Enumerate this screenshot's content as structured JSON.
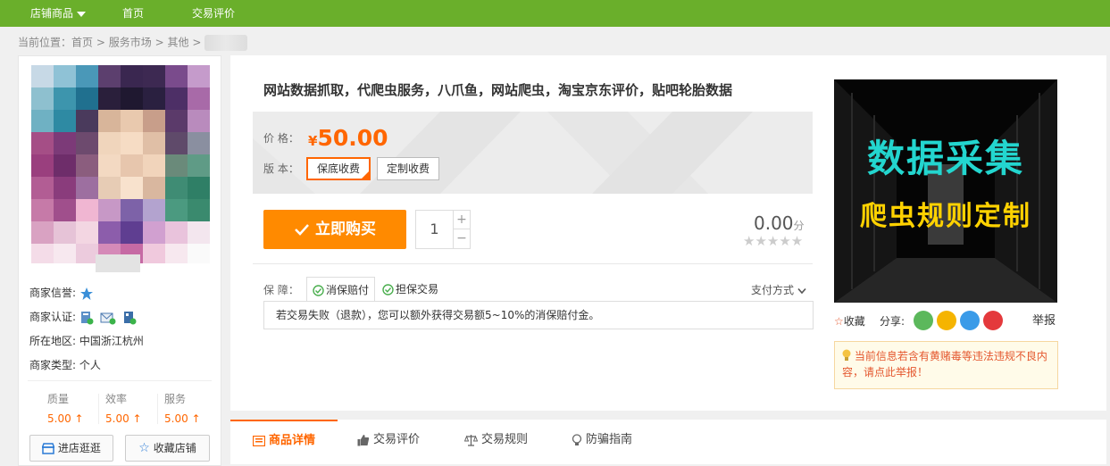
{
  "topbar": {
    "items": [
      {
        "label": "店铺商品"
      },
      {
        "label": "首页"
      },
      {
        "label": "交易评价"
      }
    ]
  },
  "breadcrumb": {
    "prefix": "当前位置：",
    "items": [
      "首页",
      "服务市场",
      "其他"
    ],
    "sep": ">"
  },
  "seller": {
    "credit_label": "商家信誉:",
    "auth_label": "商家认证:",
    "region_label": "所在地区:",
    "region_value": "中国浙江杭州",
    "type_label": "商家类型:",
    "type_value": "个人",
    "stats": [
      {
        "label": "质量",
        "value": "5.00 ↑"
      },
      {
        "label": "效率",
        "value": "5.00 ↑"
      },
      {
        "label": "服务",
        "value": "5.00 ↑"
      }
    ],
    "visit_button": "进店逛逛",
    "favorite_shop_button": "收藏店铺"
  },
  "product": {
    "title": "网站数据抓取，代爬虫服务，八爪鱼，网站爬虫，淘宝京东评价，贴吧轮胎数据",
    "price_label": "价  格：",
    "currency": "¥",
    "price": "50.00",
    "version_label": "版  本：",
    "versions": [
      "保底收费",
      "定制收费"
    ],
    "buy_button": "立即购买",
    "quantity": "1",
    "score": "0.00",
    "score_unit": "分",
    "stars": "★★★★★",
    "guarantee_label": "保  障：",
    "guarantees": [
      "消保赔付",
      "担保交易"
    ],
    "pay_method": "支付方式",
    "guarantee_desc": "若交易失败（退款），您可以额外获得交易额5~10%的消保赔付金。"
  },
  "ad": {
    "line1": "数据采集",
    "line2": "爬虫规则定制"
  },
  "actions": {
    "favorite": "收藏",
    "share_label": "分享:",
    "report": "举报",
    "warning": "当前信息若含有黄赌毒等违法违规不良内容，请点此举报！"
  },
  "tabs": [
    {
      "label": "商品详情"
    },
    {
      "label": "交易评价"
    },
    {
      "label": "交易规则"
    },
    {
      "label": "防骗指南"
    }
  ],
  "colors": {
    "topbar": "#6aaf2b",
    "accent": "#ff6600",
    "buy": "#ff8a00"
  }
}
